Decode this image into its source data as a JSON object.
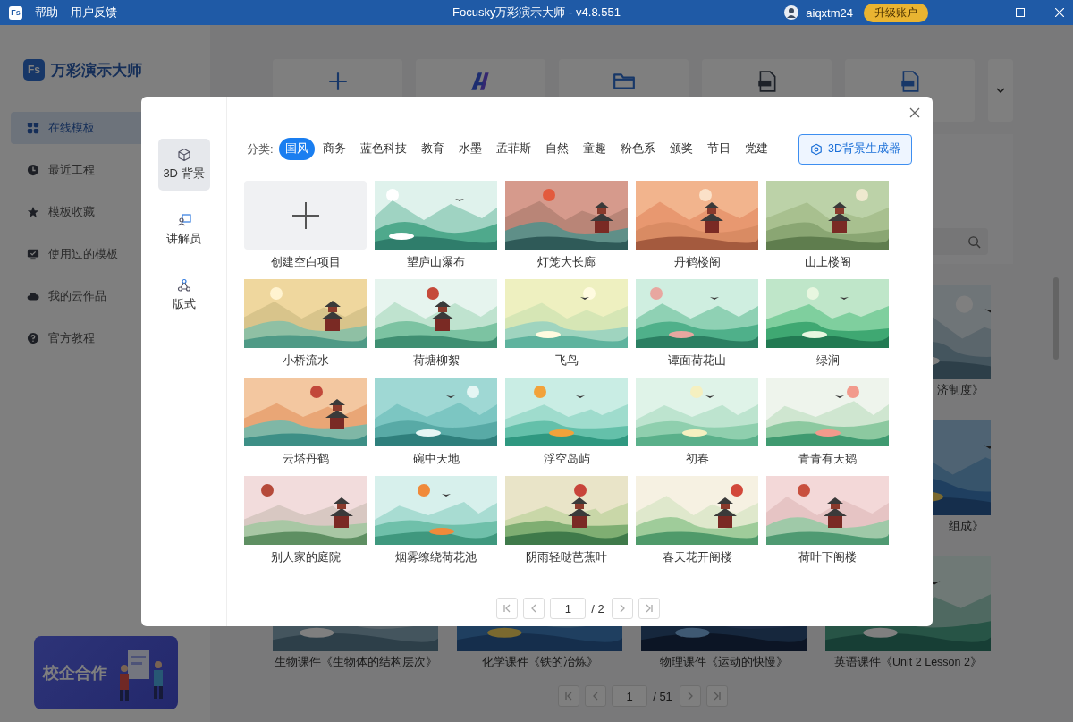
{
  "title_bar": {
    "app_icon": "Fs",
    "menu": [
      "帮助",
      "用户反馈"
    ],
    "title": "Focusky万彩演示大师 - v4.8.551",
    "username": "aiqxtm24",
    "upgrade_button": "升级账户"
  },
  "sidebar": {
    "logo_icon": "Fs",
    "logo_text": "万彩演示大师",
    "items": [
      {
        "label": "在线模板",
        "selected": true
      },
      {
        "label": "最近工程",
        "selected": false
      },
      {
        "label": "模板收藏",
        "selected": false
      },
      {
        "label": "使用过的模板",
        "selected": false
      },
      {
        "label": "我的云作品",
        "selected": false
      },
      {
        "label": "官方教程",
        "selected": false
      }
    ],
    "banner": "校企合作"
  },
  "template_gallery": {
    "partial_captions": [
      "济制度》",
      "组成》"
    ],
    "bottom_row": [
      {
        "caption": "生物课件《生物体的结构层次》"
      },
      {
        "caption": "化学课件《铁的冶炼》"
      },
      {
        "caption": "物理课件《运动的快慢》"
      },
      {
        "caption": "英语课件《Unit 2 Lesson 2》"
      }
    ],
    "pagination": {
      "page": "1",
      "total": "/ 51"
    }
  },
  "dialog": {
    "nav": [
      {
        "label": "3D 背景",
        "selected": true
      },
      {
        "label": "讲解员",
        "selected": false
      },
      {
        "label": "版式",
        "selected": false
      }
    ],
    "category_label": "分类:",
    "categories": [
      {
        "label": "国风",
        "selected": true
      },
      {
        "label": "商务",
        "selected": false
      },
      {
        "label": "蓝色科技",
        "selected": false
      },
      {
        "label": "教育",
        "selected": false
      },
      {
        "label": "水墨",
        "selected": false
      },
      {
        "label": "孟菲斯",
        "selected": false
      },
      {
        "label": "自然",
        "selected": false
      },
      {
        "label": "童趣",
        "selected": false
      },
      {
        "label": "粉色系",
        "selected": false
      },
      {
        "label": "颁奖",
        "selected": false
      },
      {
        "label": "节日",
        "selected": false
      },
      {
        "label": "党建",
        "selected": false
      }
    ],
    "generator_button": "3D背景生成器",
    "cards": [
      {
        "kind": "blank",
        "caption": "创建空白项目"
      },
      {
        "kind": "picture",
        "caption": "望庐山瀑布"
      },
      {
        "kind": "picture",
        "caption": "灯笼大长廊"
      },
      {
        "kind": "picture",
        "caption": "丹鹤楼阁"
      },
      {
        "kind": "picture",
        "caption": "山上楼阁"
      },
      {
        "kind": "picture",
        "caption": "小桥流水"
      },
      {
        "kind": "picture",
        "caption": "荷塘柳絮"
      },
      {
        "kind": "picture",
        "caption": "飞鸟"
      },
      {
        "kind": "picture",
        "caption": "谭面荷花山"
      },
      {
        "kind": "picture",
        "caption": "绿涧"
      },
      {
        "kind": "picture",
        "caption": "云塔丹鹤"
      },
      {
        "kind": "picture",
        "caption": "碗中天地"
      },
      {
        "kind": "picture",
        "caption": "浮空岛屿"
      },
      {
        "kind": "picture",
        "caption": "初春"
      },
      {
        "kind": "picture",
        "caption": "青青有天鹅"
      },
      {
        "kind": "picture",
        "caption": "别人家的庭院"
      },
      {
        "kind": "picture",
        "caption": "烟雾缭绕荷花池"
      },
      {
        "kind": "picture",
        "caption": "阴雨轻哒芭蕉叶"
      },
      {
        "kind": "picture",
        "caption": "春天花开阁楼"
      },
      {
        "kind": "picture",
        "caption": "荷叶下阁楼"
      }
    ],
    "pagination": {
      "page": "1",
      "total": "/ 2"
    }
  }
}
